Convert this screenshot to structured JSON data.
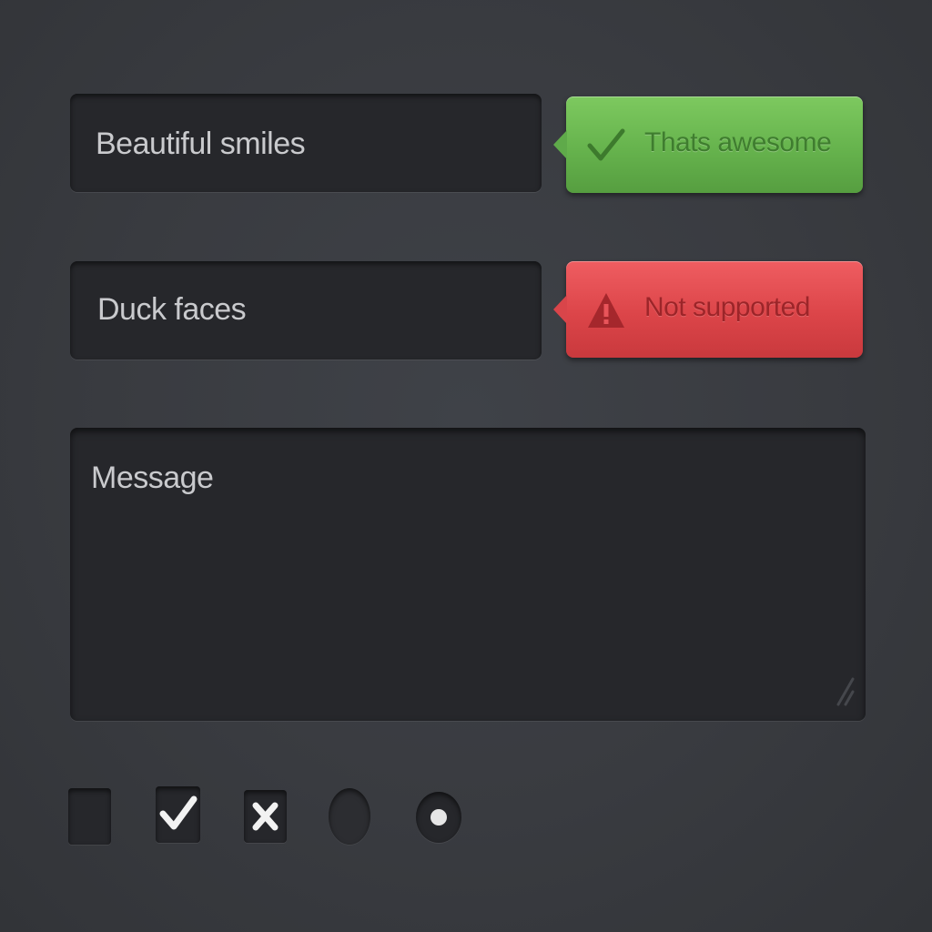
{
  "fields": [
    {
      "value": "Beautiful smiles"
    },
    {
      "value": "Duck faces"
    }
  ],
  "tooltips": {
    "success": {
      "text": "Thats awesome",
      "icon": "checkmark-icon",
      "color": "#66b34d"
    },
    "error": {
      "text": "Not supported",
      "icon": "warning-icon",
      "color": "#dc4549"
    }
  },
  "message": {
    "placeholder": "Message"
  },
  "controls": {
    "checkbox_empty": {
      "checked": false
    },
    "checkbox_checked": {
      "checked": true,
      "icon": "check-icon"
    },
    "checkbox_x": {
      "checked": true,
      "icon": "x-icon"
    },
    "radio_empty": {
      "selected": false
    },
    "radio_selected": {
      "selected": true
    }
  },
  "colors": {
    "background": "#3a3c41",
    "field": "#26272b",
    "field_text": "#c9cacd",
    "success": "#66b34d",
    "error": "#dc4549"
  }
}
